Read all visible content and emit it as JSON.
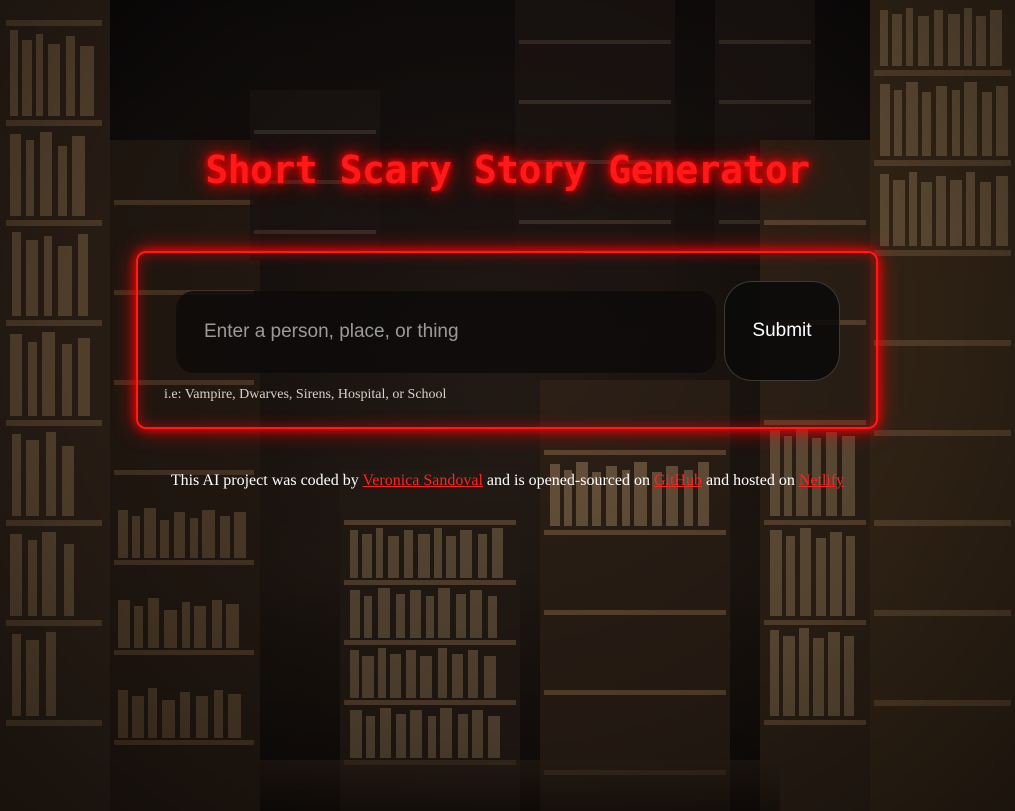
{
  "header": {
    "title": "Short Scary Story Generator"
  },
  "form": {
    "input_placeholder": "Enter a person, place, or thing",
    "input_value": "",
    "submit_label": "Submit",
    "hint": "i.e: Vampire, Dwarves, Sirens, Hospital, or School"
  },
  "footer": {
    "text_1": "This AI project was coded by",
    "author_link": "Veronica Sandoval",
    "text_2": "and is opened-sourced on",
    "github_link": "GitHub",
    "text_3": "and hosted on",
    "netlify_link": "Netlify"
  },
  "colors": {
    "accent": "#ff1a1a",
    "background": "#2a1e16"
  }
}
